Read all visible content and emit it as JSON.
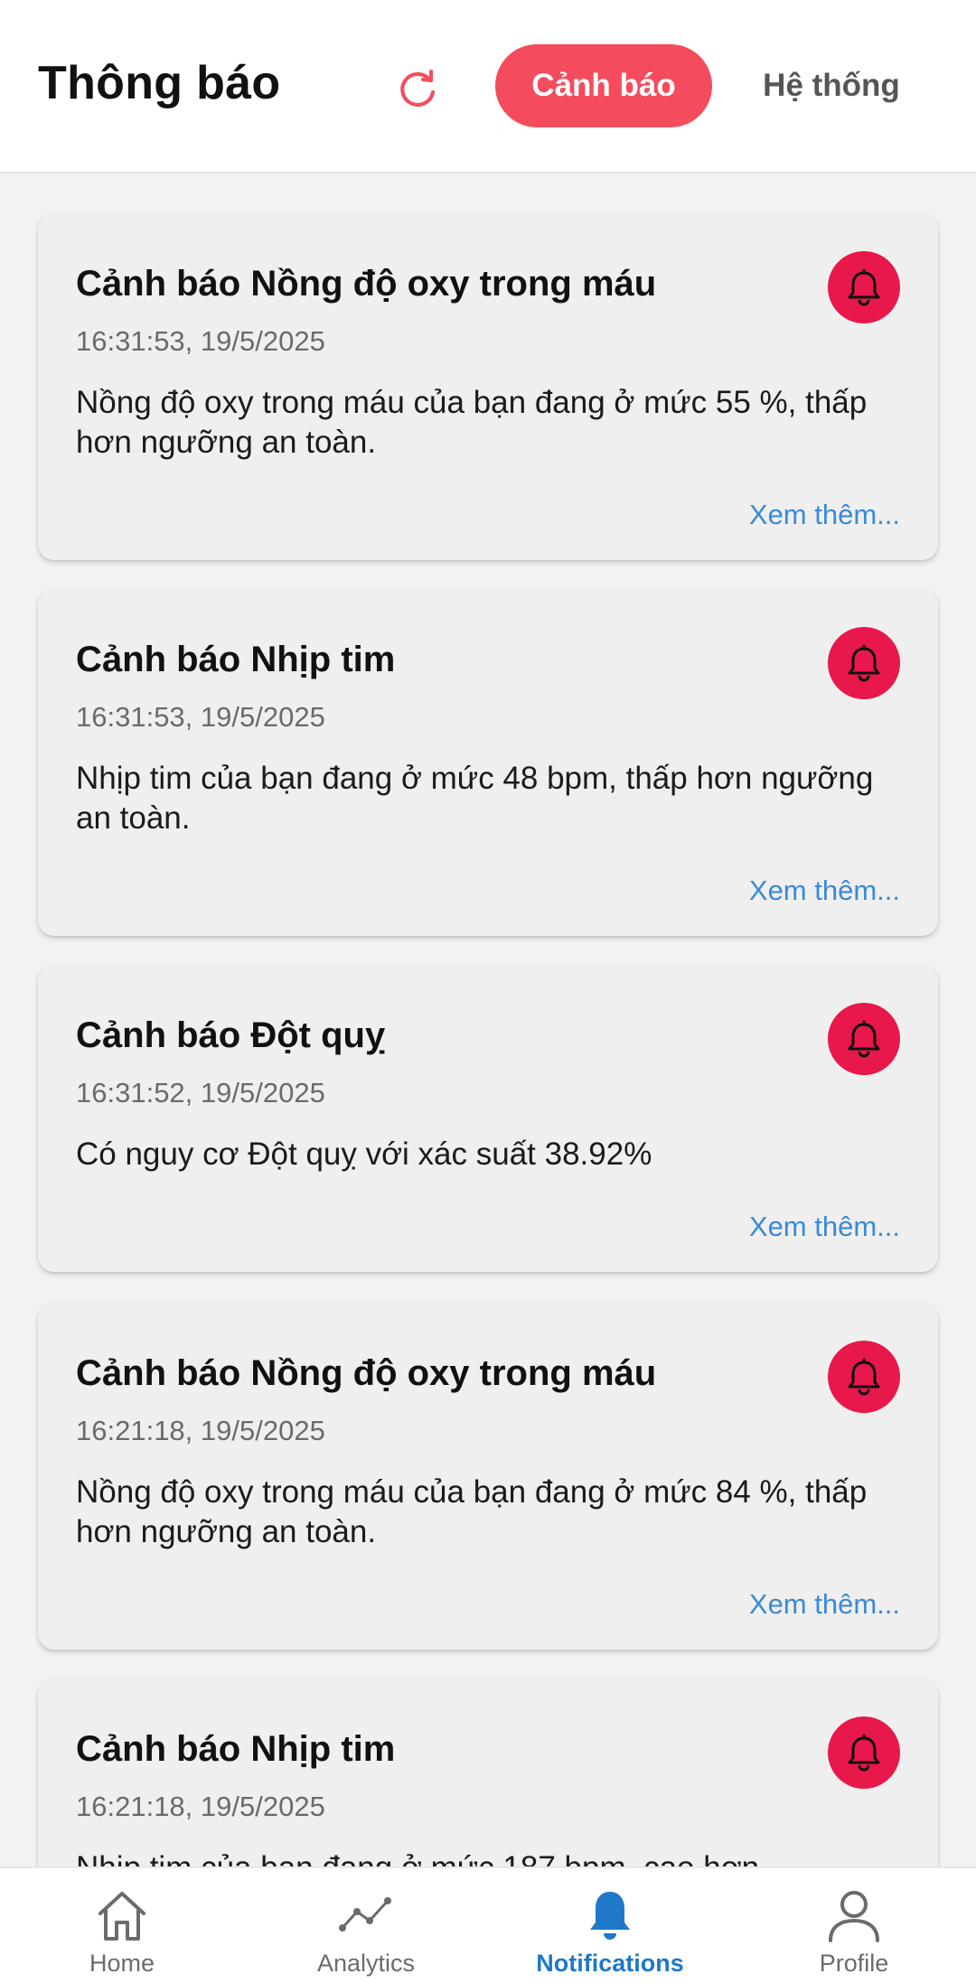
{
  "header": {
    "title": "Thông báo",
    "tabs": [
      {
        "label": "Cảnh báo",
        "active": true
      },
      {
        "label": "Hệ thống",
        "active": false
      }
    ]
  },
  "colors": {
    "accent": "#f44c5c",
    "bell_badge": "#e8184a",
    "link": "#3a8ad6",
    "nav_active": "#1f78c8"
  },
  "notifications": [
    {
      "title": "Cảnh báo Nồng độ oxy trong máu",
      "time": "16:31:53, 19/5/2025",
      "body": "Nồng độ oxy trong máu của bạn đang ở mức 55 %, thấp hơn ngưỡng an toàn.",
      "more": "Xem thêm...",
      "icon": "bell-icon"
    },
    {
      "title": "Cảnh báo Nhịp tim",
      "time": "16:31:53, 19/5/2025",
      "body": "Nhịp tim của bạn đang ở mức 48 bpm, thấp hơn ngưỡng an toàn.",
      "more": "Xem thêm...",
      "icon": "bell-icon"
    },
    {
      "title": "Cảnh báo Đột quỵ",
      "time": "16:31:52, 19/5/2025",
      "body": "Có nguy cơ Đột quỵ với xác suất 38.92%",
      "more": "Xem thêm...",
      "icon": "bell-icon"
    },
    {
      "title": "Cảnh báo Nồng độ oxy trong máu",
      "time": "16:21:18, 19/5/2025",
      "body": "Nồng độ oxy trong máu của bạn đang ở mức 84 %, thấp hơn ngưỡng an toàn.",
      "more": "Xem thêm...",
      "icon": "bell-icon"
    },
    {
      "title": "Cảnh báo Nhịp tim",
      "time": "16:21:18, 19/5/2025",
      "body": "Nhịp tim của bạn đang ở mức 187 bpm, cao hơn",
      "icon": "bell-icon"
    }
  ],
  "bottom_nav": [
    {
      "label": "Home",
      "icon": "home-icon",
      "active": false
    },
    {
      "label": "Analytics",
      "icon": "analytics-icon",
      "active": false
    },
    {
      "label": "Notifications",
      "icon": "bell-icon",
      "active": true
    },
    {
      "label": "Profile",
      "icon": "profile-icon",
      "active": false
    }
  ]
}
